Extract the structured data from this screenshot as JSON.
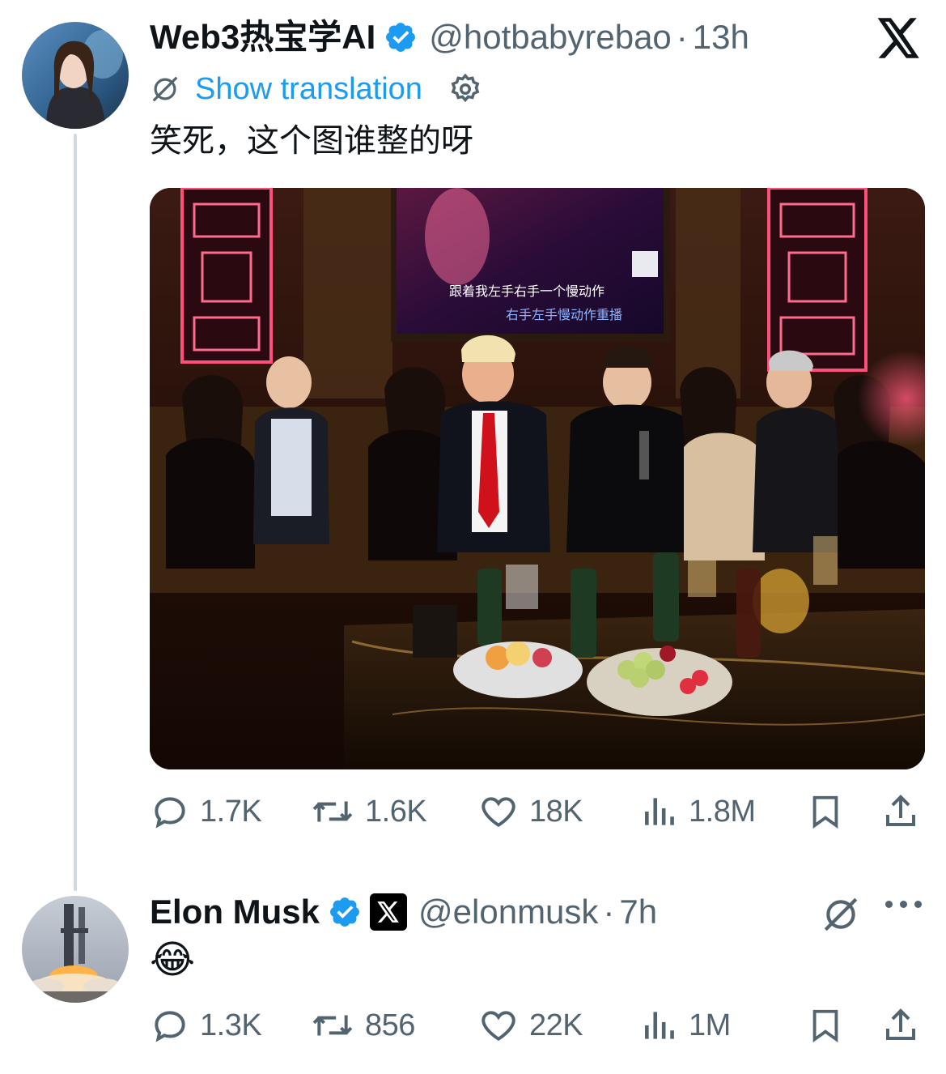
{
  "tweet": {
    "author": {
      "name": "Web3热宝学AI",
      "handle": "@hotbabyrebao",
      "separator": "·",
      "time": "13h",
      "avatar_icon": "avatar-woman-photo"
    },
    "translate_label": "Show translation",
    "text": "笑死，这个图谁整的呀",
    "media_caption_lines": [
      "跟着我左手右手一个慢动作",
      "右手左手慢动作重播"
    ],
    "stats": {
      "replies": "1.7K",
      "reposts": "1.6K",
      "likes": "18K",
      "views": "1.8M"
    }
  },
  "reply": {
    "author": {
      "name": "Elon Musk",
      "handle": "@elonmusk",
      "separator": "·",
      "time": "7h",
      "avatar_icon": "avatar-rocket-launch"
    },
    "text": "😂",
    "stats": {
      "replies": "1.3K",
      "reposts": "856",
      "likes": "22K",
      "views": "1M"
    }
  },
  "colors": {
    "accent": "#1d9bf0",
    "secondary_text": "#536471",
    "thread_line": "#cfd9de",
    "verified": "#1d9bf0"
  }
}
